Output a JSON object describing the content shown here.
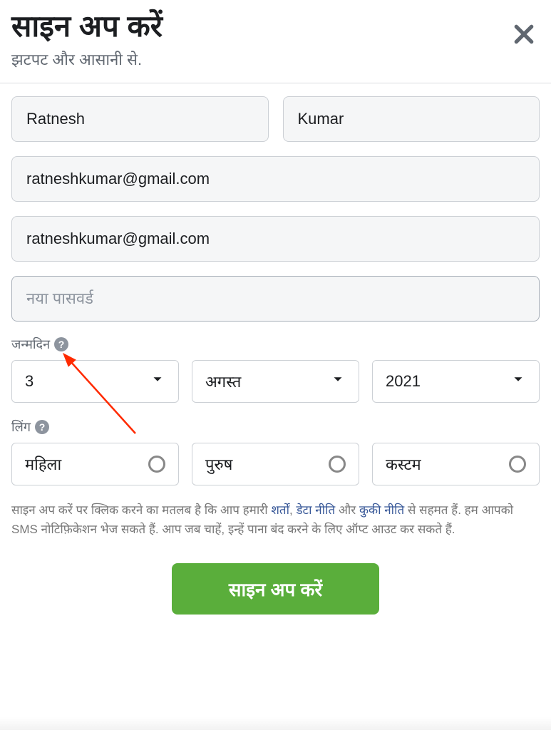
{
  "header": {
    "title": "साइन अप करें",
    "subtitle": "झटपट और आसानी से."
  },
  "fields": {
    "first_name": "Ratnesh",
    "last_name": "Kumar",
    "email": "ratneshkumar@gmail.com",
    "email_confirm": "ratneshkumar@gmail.com",
    "password_placeholder": "नया पासवर्ड"
  },
  "dob": {
    "label": "जन्मदिन",
    "day": "3",
    "month": "अगस्त",
    "year": "2021"
  },
  "gender": {
    "label": "लिंग",
    "options": [
      "महिला",
      "पुरुष",
      "कस्टम"
    ]
  },
  "terms": {
    "prefix": "साइन अप करें पर क्लिक करने का मतलब है कि आप हमारी ",
    "terms_link": "शर्तों",
    "sep1": ", ",
    "data_link": "डेटा नीति",
    "sep2": " और ",
    "cookie_link": "कुकी नीति",
    "suffix": " से सहमत हैं. हम आपको SMS नोटिफ़िकेशन भेज सकते हैं. आप जब चाहें, इन्हें पाना बंद करने के लिए ऑप्ट आउट कर सकते हैं."
  },
  "submit_label": "साइन अप करें"
}
